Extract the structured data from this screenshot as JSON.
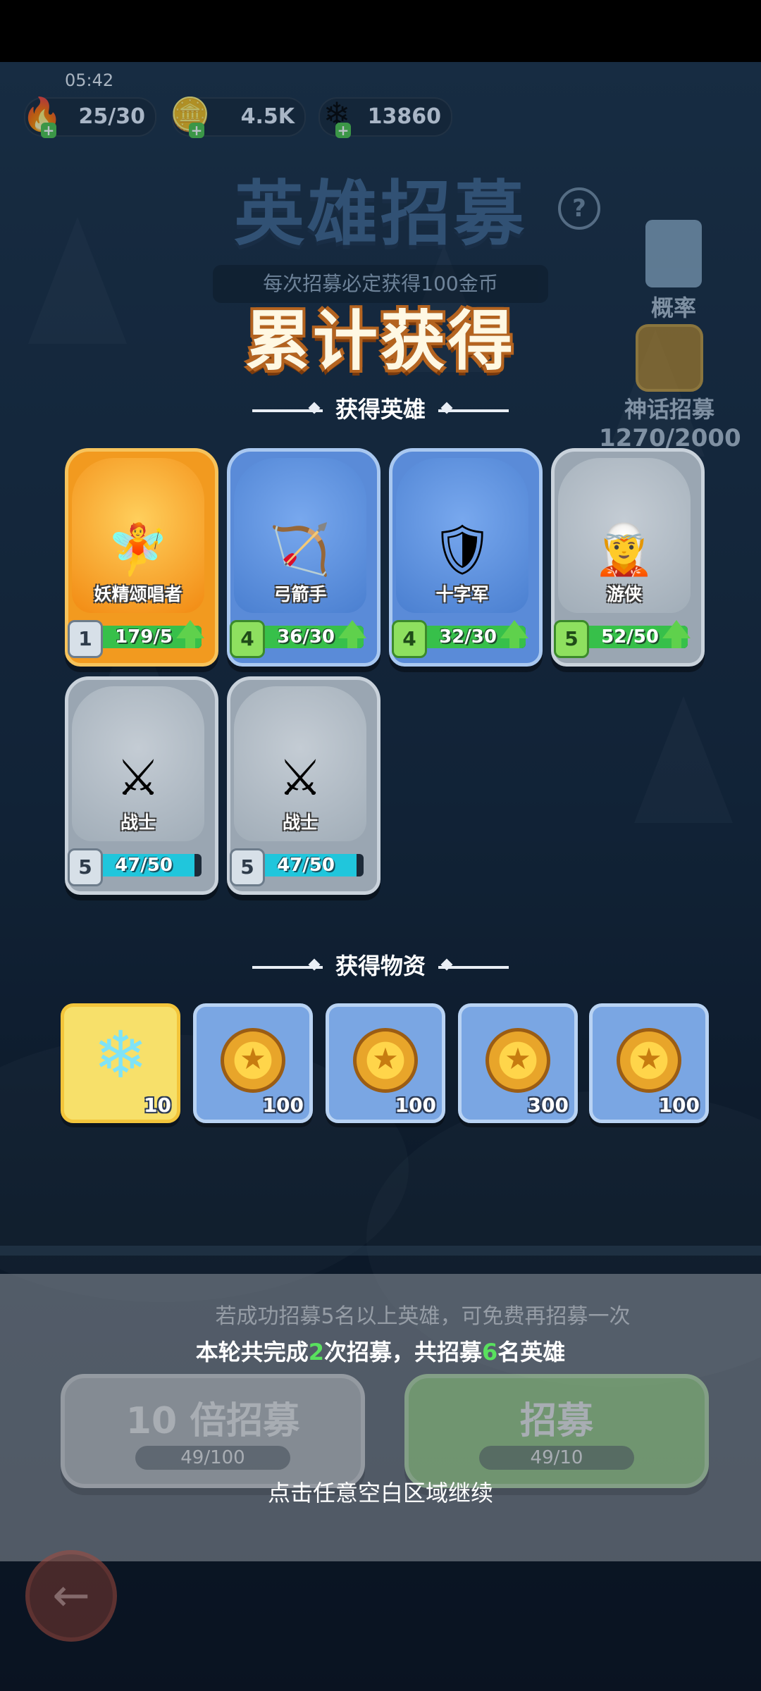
{
  "status": {
    "time": "05:42"
  },
  "resources": [
    {
      "icon": "energy-icon",
      "value": "25/30"
    },
    {
      "icon": "gold-coin-icon",
      "value": "4.5K"
    },
    {
      "icon": "crystal-icon",
      "value": "13860"
    }
  ],
  "header": {
    "title": "英雄招募",
    "note": "每次招募必定获得100金币",
    "probability_label": "概率",
    "myth_label": "神话招募",
    "myth_progress": "1270/2000"
  },
  "result": {
    "headline": "累计获得",
    "heroes_title": "获得英雄",
    "heroes": [
      {
        "name": "妖精颂唱者",
        "level": "1",
        "progress": "179/5",
        "fill": 1.0,
        "rarity": "orange",
        "avatar": "🧚"
      },
      {
        "name": "弓箭手",
        "level": "4",
        "progress": "36/30",
        "fill": 1.0,
        "rarity": "blue",
        "avatar": "🏹"
      },
      {
        "name": "十字军",
        "level": "4",
        "progress": "32/30",
        "fill": 1.0,
        "rarity": "blue",
        "avatar": "🛡"
      },
      {
        "name": "游侠",
        "level": "5",
        "progress": "52/50",
        "fill": 1.0,
        "rarity": "gray",
        "avatar": "🧝"
      },
      {
        "name": "战士",
        "level": "5",
        "progress": "47/50",
        "fill": 0.94,
        "rarity": "gray",
        "avatar": "⚔"
      },
      {
        "name": "战士",
        "level": "5",
        "progress": "47/50",
        "fill": 0.94,
        "rarity": "gray",
        "avatar": "⚔"
      }
    ],
    "items_title": "获得物资",
    "items": [
      {
        "type": "crystal",
        "qty": "10"
      },
      {
        "type": "coin",
        "qty": "100"
      },
      {
        "type": "coin",
        "qty": "100"
      },
      {
        "type": "coin",
        "qty": "300"
      },
      {
        "type": "coin",
        "qty": "100"
      }
    ]
  },
  "bottom": {
    "free_tip": "若成功招募5名以上英雄，可免费再招募一次",
    "summary_prefix": "本轮共完成",
    "summary_count": "2",
    "summary_mid": "次招募，共招募",
    "summary_heroes": "6",
    "summary_suffix": "名英雄",
    "btn_ten_label": "10 倍招募",
    "btn_ten_cost": "49/100",
    "btn_one_label": "招募",
    "btn_one_cost": "49/10",
    "tap_hint": "点击任意空白区域继续"
  },
  "colors": {
    "accent": "#59e05e",
    "headline_outline": "#b4631f"
  }
}
